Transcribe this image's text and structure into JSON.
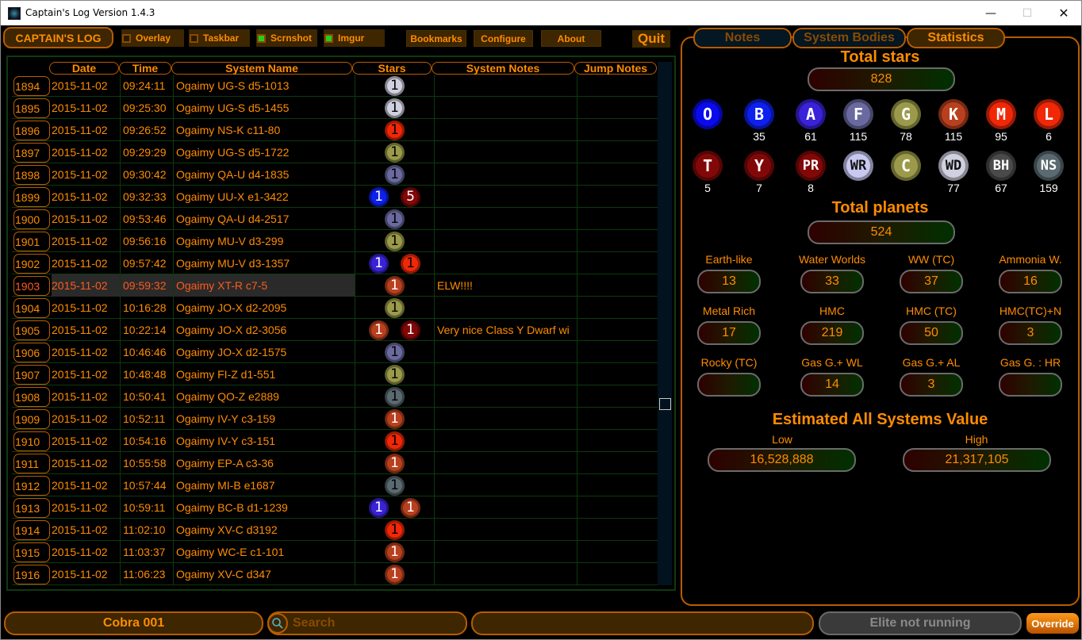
{
  "window": {
    "title": "Captain's Log Version 1.4.3",
    "minimize": "—",
    "maximize": "☐",
    "close": "✕"
  },
  "toolbar": {
    "captains_log": "CAPTAIN'S LOG",
    "checkboxes": [
      {
        "label": "Overlay",
        "checked": false
      },
      {
        "label": "Taskbar",
        "checked": false
      },
      {
        "label": "Scrnshot",
        "checked": true
      },
      {
        "label": "Imgur",
        "checked": true
      }
    ],
    "bookmarks": "Bookmarks",
    "configure": "Configure",
    "about": "About",
    "quit": "Quit"
  },
  "log": {
    "columns": [
      "Date",
      "Time",
      "System Name",
      "Stars",
      "System Notes",
      "Jump Notes"
    ],
    "selected_id": "1903",
    "rows": [
      {
        "id": "1894",
        "date": "2015-11-02",
        "time": "09:24:11",
        "system": "Ogaimy UG-S d5-1013",
        "stars": [
          {
            "type": "WD",
            "count": "1"
          }
        ],
        "notes": "",
        "jump": ""
      },
      {
        "id": "1895",
        "date": "2015-11-02",
        "time": "09:25:30",
        "system": "Ogaimy UG-S d5-1455",
        "stars": [
          {
            "type": "WD",
            "count": "1"
          }
        ],
        "notes": "",
        "jump": ""
      },
      {
        "id": "1896",
        "date": "2015-11-02",
        "time": "09:26:52",
        "system": "Ogaimy NS-K c11-80",
        "stars": [
          {
            "type": "M",
            "count": "1"
          }
        ],
        "notes": "",
        "jump": ""
      },
      {
        "id": "1897",
        "date": "2015-11-02",
        "time": "09:29:29",
        "system": "Ogaimy UG-S d5-1722",
        "stars": [
          {
            "type": "G",
            "count": "1"
          }
        ],
        "notes": "",
        "jump": ""
      },
      {
        "id": "1898",
        "date": "2015-11-02",
        "time": "09:30:42",
        "system": "Ogaimy QA-U d4-1835",
        "stars": [
          {
            "type": "F",
            "count": "1"
          }
        ],
        "notes": "",
        "jump": ""
      },
      {
        "id": "1899",
        "date": "2015-11-02",
        "time": "09:32:33",
        "system": "Ogaimy UU-X e1-3422",
        "stars": [
          {
            "type": "B",
            "count": "1"
          },
          {
            "type": "T",
            "count": "5"
          }
        ],
        "notes": "",
        "jump": ""
      },
      {
        "id": "1900",
        "date": "2015-11-02",
        "time": "09:53:46",
        "system": "Ogaimy QA-U d4-2517",
        "stars": [
          {
            "type": "F",
            "count": "1"
          }
        ],
        "notes": "",
        "jump": ""
      },
      {
        "id": "1901",
        "date": "2015-11-02",
        "time": "09:56:16",
        "system": "Ogaimy MU-V d3-299",
        "stars": [
          {
            "type": "G",
            "count": "1"
          }
        ],
        "notes": "",
        "jump": ""
      },
      {
        "id": "1902",
        "date": "2015-11-02",
        "time": "09:57:42",
        "system": "Ogaimy MU-V d3-1357",
        "stars": [
          {
            "type": "A",
            "count": "1"
          },
          {
            "type": "M",
            "count": "1"
          }
        ],
        "notes": "",
        "jump": ""
      },
      {
        "id": "1903",
        "date": "2015-11-02",
        "time": "09:59:32",
        "system": "Ogaimy XT-R c7-5",
        "stars": [
          {
            "type": "K",
            "count": "1"
          }
        ],
        "notes": "ELW!!!!",
        "jump": ""
      },
      {
        "id": "1904",
        "date": "2015-11-02",
        "time": "10:16:28",
        "system": "Ogaimy JO-X d2-2095",
        "stars": [
          {
            "type": "G",
            "count": "1"
          }
        ],
        "notes": "",
        "jump": ""
      },
      {
        "id": "1905",
        "date": "2015-11-02",
        "time": "10:22:14",
        "system": "Ogaimy JO-X d2-3056",
        "stars": [
          {
            "type": "K",
            "count": "1"
          },
          {
            "type": "Y",
            "count": "1"
          }
        ],
        "notes": "Very nice Class Y Dwarf wi",
        "jump": ""
      },
      {
        "id": "1906",
        "date": "2015-11-02",
        "time": "10:46:46",
        "system": "Ogaimy JO-X d2-1575",
        "stars": [
          {
            "type": "F",
            "count": "1"
          }
        ],
        "notes": "",
        "jump": ""
      },
      {
        "id": "1907",
        "date": "2015-11-02",
        "time": "10:48:48",
        "system": "Ogaimy FI-Z d1-551",
        "stars": [
          {
            "type": "G",
            "count": "1"
          }
        ],
        "notes": "",
        "jump": ""
      },
      {
        "id": "1908",
        "date": "2015-11-02",
        "time": "10:50:41",
        "system": "Ogaimy QO-Z e2889",
        "stars": [
          {
            "type": "NS",
            "count": "1"
          }
        ],
        "notes": "",
        "jump": ""
      },
      {
        "id": "1909",
        "date": "2015-11-02",
        "time": "10:52:11",
        "system": "Ogaimy IV-Y c3-159",
        "stars": [
          {
            "type": "K",
            "count": "1"
          }
        ],
        "notes": "",
        "jump": ""
      },
      {
        "id": "1910",
        "date": "2015-11-02",
        "time": "10:54:16",
        "system": "Ogaimy IV-Y c3-151",
        "stars": [
          {
            "type": "M",
            "count": "1"
          }
        ],
        "notes": "",
        "jump": ""
      },
      {
        "id": "1911",
        "date": "2015-11-02",
        "time": "10:55:58",
        "system": "Ogaimy EP-A c3-36",
        "stars": [
          {
            "type": "K",
            "count": "1"
          }
        ],
        "notes": "",
        "jump": ""
      },
      {
        "id": "1912",
        "date": "2015-11-02",
        "time": "10:57:44",
        "system": "Ogaimy MI-B e1687",
        "stars": [
          {
            "type": "NS",
            "count": "1"
          }
        ],
        "notes": "",
        "jump": ""
      },
      {
        "id": "1913",
        "date": "2015-11-02",
        "time": "10:59:11",
        "system": "Ogaimy BC-B d1-1239",
        "stars": [
          {
            "type": "A",
            "count": "1"
          },
          {
            "type": "K",
            "count": "1"
          }
        ],
        "notes": "",
        "jump": ""
      },
      {
        "id": "1914",
        "date": "2015-11-02",
        "time": "11:02:10",
        "system": "Ogaimy XV-C d3192",
        "stars": [
          {
            "type": "M",
            "count": "1"
          }
        ],
        "notes": "",
        "jump": ""
      },
      {
        "id": "1915",
        "date": "2015-11-02",
        "time": "11:03:37",
        "system": "Ogaimy WC-E c1-101",
        "stars": [
          {
            "type": "K",
            "count": "1"
          }
        ],
        "notes": "",
        "jump": ""
      },
      {
        "id": "1916",
        "date": "2015-11-02",
        "time": "11:06:23",
        "system": "Ogaimy XV-C d347",
        "stars": [
          {
            "type": "K",
            "count": "1"
          }
        ],
        "notes": "",
        "jump": ""
      }
    ]
  },
  "star_colors": {
    "O": {
      "bg": "#0a0aee",
      "fg": "#ffffff"
    },
    "B": {
      "bg": "#0d20ee",
      "fg": "#ffffff"
    },
    "A": {
      "bg": "#3a22d8",
      "fg": "#ffffff"
    },
    "F": {
      "bg": "#6a6aa0",
      "fg": "#ffffff"
    },
    "G": {
      "bg": "#9a9a4a",
      "fg": "#ffffff"
    },
    "K": {
      "bg": "#b8401e",
      "fg": "#ffffff"
    },
    "M": {
      "bg": "#f02808",
      "fg": "#ffffff"
    },
    "L": {
      "bg": "#f02808",
      "fg": "#ffffff"
    },
    "T": {
      "bg": "#820808",
      "fg": "#ffffff"
    },
    "Y": {
      "bg": "#820808",
      "fg": "#ffffff"
    },
    "PR": {
      "bg": "#820808",
      "fg": "#ffffff"
    },
    "WR": {
      "bg": "#c8c8f0",
      "fg": "#000000"
    },
    "C": {
      "bg": "#9a9a4a",
      "fg": "#ffffff"
    },
    "WD": {
      "bg": "#d0d0e0",
      "fg": "#000000"
    },
    "BH": {
      "bg": "#4a4a4a",
      "fg": "#ffffff"
    },
    "NS": {
      "bg": "#5a6a70",
      "fg": "#ffffff"
    }
  },
  "row_star_fg": {
    "WD": "#000000",
    "M": "#000000",
    "G": "#000000",
    "F": "#000000",
    "NS": "#000000",
    "B": "#ffffff",
    "A": "#ffffff",
    "T": "#ffffff",
    "K": "#ffffff",
    "Y": "#ffffff"
  },
  "tabs": [
    {
      "label": "Notes",
      "active": false
    },
    {
      "label": "System Bodies",
      "active": false
    },
    {
      "label": "Statistics",
      "active": true
    }
  ],
  "stats": {
    "total_stars_title": "Total stars",
    "total_stars": "828",
    "star_types": [
      {
        "type": "O",
        "label": "O",
        "count": ""
      },
      {
        "type": "B",
        "label": "B",
        "count": "35"
      },
      {
        "type": "A",
        "label": "A",
        "count": "61"
      },
      {
        "type": "F",
        "label": "F",
        "count": "115"
      },
      {
        "type": "G",
        "label": "G",
        "count": "78"
      },
      {
        "type": "K",
        "label": "K",
        "count": "115"
      },
      {
        "type": "M",
        "label": "M",
        "count": "95"
      },
      {
        "type": "L",
        "label": "L",
        "count": "6"
      },
      {
        "type": "T",
        "label": "T",
        "count": "5"
      },
      {
        "type": "Y",
        "label": "Y",
        "count": "7"
      },
      {
        "type": "PR",
        "label": "PR",
        "count": "8"
      },
      {
        "type": "WR",
        "label": "WR",
        "count": ""
      },
      {
        "type": "C",
        "label": "C",
        "count": ""
      },
      {
        "type": "WD",
        "label": "WD",
        "count": "77"
      },
      {
        "type": "BH",
        "label": "BH",
        "count": "67"
      },
      {
        "type": "NS",
        "label": "NS",
        "count": "159"
      }
    ],
    "total_planets_title": "Total planets",
    "total_planets": "524",
    "planet_types": [
      {
        "label": "Earth-like",
        "value": "13"
      },
      {
        "label": "Water Worlds",
        "value": "33"
      },
      {
        "label": "WW (TC)",
        "value": "37"
      },
      {
        "label": "Ammonia W.",
        "value": "16"
      },
      {
        "label": "Metal Rich",
        "value": "17"
      },
      {
        "label": "HMC",
        "value": "219"
      },
      {
        "label": "HMC (TC)",
        "value": "50"
      },
      {
        "label": "HMC(TC)+N",
        "value": "3"
      },
      {
        "label": "Rocky (TC)",
        "value": ""
      },
      {
        "label": "Gas G.+ WL",
        "value": "14"
      },
      {
        "label": "Gas G.+ AL",
        "value": "3"
      },
      {
        "label": "Gas G. : HR",
        "value": ""
      }
    ],
    "value_title": "Estimated All Systems Value",
    "low_label": "Low",
    "low_value": "16,528,888",
    "high_label": "High",
    "high_value": "21,317,105"
  },
  "bottom": {
    "ship": "Cobra 001",
    "search_placeholder": "Search",
    "status": "",
    "elite_status": "Elite not running",
    "override": "Override"
  }
}
